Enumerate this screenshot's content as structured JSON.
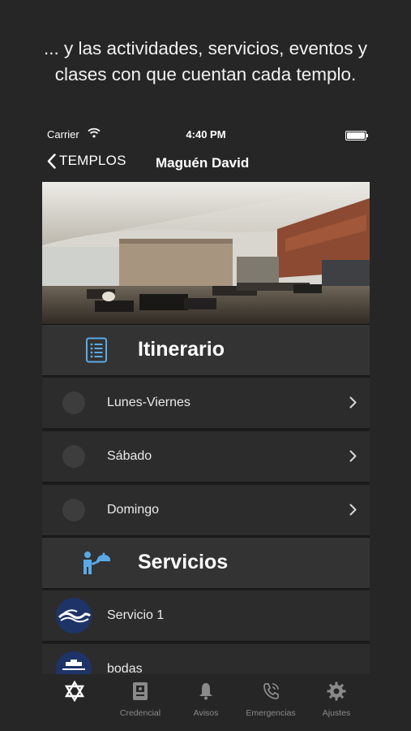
{
  "caption": {
    "line1": "... y las actividades, servicios, eventos y",
    "line2": "clases con que cuentan cada templo."
  },
  "status_bar": {
    "carrier": "Carrier",
    "time": "4:40 PM"
  },
  "navbar": {
    "back_label": "TEMPLOS",
    "title": "Maguén David"
  },
  "itinerario": {
    "title": "Itinerario",
    "icon": "list-document-icon",
    "items": [
      {
        "label": "Lunes-Viernes"
      },
      {
        "label": "Sábado"
      },
      {
        "label": "Domingo"
      }
    ]
  },
  "servicios": {
    "title": "Servicios",
    "icon": "service-waiter-icon",
    "items": [
      {
        "label": "Servicio 1",
        "icon": "wave-logo-icon"
      },
      {
        "label": "bodas",
        "icon": "wedding-logo-icon"
      }
    ]
  },
  "tabbar": {
    "items": [
      {
        "label": "",
        "icon": "star-of-david-icon"
      },
      {
        "label": "Credencial",
        "icon": "id-card-icon"
      },
      {
        "label": "Avisos",
        "icon": "bell-icon"
      },
      {
        "label": "Emergencias",
        "icon": "phone-icon"
      },
      {
        "label": "Ajustes",
        "icon": "gear-icon"
      }
    ]
  },
  "colors": {
    "accent": "#5aa9e6",
    "background": "#262626",
    "header": "#333333",
    "row": "#2c2c2c"
  }
}
